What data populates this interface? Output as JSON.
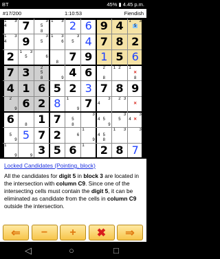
{
  "status_bar": {
    "left": "BT",
    "right_battery": "45%",
    "time": "4.45 p.m."
  },
  "info_bar": {
    "puzzle": "#17/200",
    "timer": "1:10:53",
    "difficulty": "Fiendish"
  },
  "hint": {
    "title": "Locked Candidates (Pointing, block)",
    "p1": "All the candidates for ",
    "digit": "digit 5",
    "p2": " in ",
    "block": "block 3",
    "p3": " are located in the intersection with ",
    "column": "column C9",
    "p4": ". Since one of the intersecting cells must contain the ",
    "digit2": "digit 5",
    "p5": ", it can be eliminated as candidate from the cells in ",
    "column2": "column C9",
    "p6": " outside the intersection."
  },
  "toolbar": {
    "buttons": [
      {
        "name": "back-button",
        "glyph": "⇐",
        "color": "#e07a10"
      },
      {
        "name": "minus-button",
        "glyph": "−",
        "color": "#e07a10"
      },
      {
        "name": "plus-button",
        "glyph": "+",
        "color": "#e07a10"
      },
      {
        "name": "close-button",
        "glyph": "✖",
        "color": "#d81c1c"
      },
      {
        "name": "forward-button",
        "glyph": "⇒",
        "color": "#e07a10"
      }
    ]
  },
  "colors": {
    "highlight_block": "#f5e3a6",
    "candidate_box": "#8ac6ff",
    "row_shade": "#cfcfcf",
    "elimination": "#d8261c"
  },
  "grid": [
    [
      {
        "v": "",
        "c": [
          "1",
          "3",
          "4"
        ]
      },
      {
        "v": "7",
        "t": "g"
      },
      {
        "v": "",
        "c": [
          "3",
          "5",
          "8"
        ]
      },
      {
        "v": "",
        "c": [
          "1",
          "3"
        ]
      },
      {
        "v": "2",
        "t": "p"
      },
      {
        "v": "6",
        "t": "p"
      },
      {
        "v": "9",
        "t": "g"
      },
      {
        "v": "4",
        "t": "g"
      },
      {
        "v": "",
        "c": [
          "1",
          "3",
          "5"
        ]
      }
    ],
    [
      {
        "v": "",
        "c": [
          "1",
          "3",
          "4"
        ]
      },
      {
        "v": "9",
        "t": "g"
      },
      {
        "v": "",
        "c": [
          "3",
          "5"
        ]
      },
      {
        "v": "",
        "c": [
          "1",
          "3",
          "6"
        ]
      },
      {
        "v": "",
        "c": [
          "3",
          "5"
        ]
      },
      {
        "v": "4",
        "t": "p"
      },
      {
        "v": "7",
        "t": "g"
      },
      {
        "v": "8",
        "t": "g"
      },
      {
        "v": "2",
        "t": "g"
      }
    ],
    [
      {
        "v": "2",
        "t": "g"
      },
      {
        "v": "",
        "c": [
          "1",
          "3",
          "5"
        ]
      },
      {
        "v": "",
        "c": [
          "6"
        ]
      },
      {
        "v": "",
        "c": [
          "8"
        ]
      },
      {
        "v": "7",
        "t": "g"
      },
      {
        "v": "9",
        "t": "g"
      },
      {
        "v": "1",
        "t": "p"
      },
      {
        "v": "5",
        "t": "g"
      },
      {
        "v": "6",
        "t": "p"
      }
    ],
    [
      {
        "v": "7",
        "t": "g"
      },
      {
        "v": "3",
        "t": "g"
      },
      {
        "v": "",
        "c": [
          "2",
          "5",
          "8"
        ]
      },
      {
        "v": "",
        "c": [
          "9"
        ]
      },
      {
        "v": "4",
        "t": "g"
      },
      {
        "v": "6",
        "t": "g"
      },
      {
        "v": "",
        "c": [
          "2",
          "8"
        ]
      },
      {
        "v": "",
        "c": [
          "1",
          "2"
        ]
      },
      {
        "v": "",
        "c": [
          "1",
          "5",
          "8"
        ],
        "x": "5"
      }
    ],
    [
      {
        "v": "4",
        "t": "g"
      },
      {
        "v": "1",
        "t": "g"
      },
      {
        "v": "6",
        "t": "g"
      },
      {
        "v": "5",
        "t": "g"
      },
      {
        "v": "2",
        "t": "g"
      },
      {
        "v": "3",
        "t": "p"
      },
      {
        "v": "7",
        "t": "g"
      },
      {
        "v": "8",
        "t": "g"
      },
      {
        "v": "9",
        "t": "g"
      }
    ],
    [
      {
        "v": "",
        "c": [
          "2",
          "9"
        ]
      },
      {
        "v": "6",
        "t": "g"
      },
      {
        "v": "2",
        "t": "g"
      },
      {
        "v": "8",
        "t": "p"
      },
      {
        "v": "",
        "c": [
          "1",
          "9"
        ]
      },
      {
        "v": "7",
        "t": "g"
      },
      {
        "v": "",
        "c": [
          "3",
          "4"
        ]
      },
      {
        "v": "",
        "c": [
          "2",
          "3"
        ]
      },
      {
        "v": "",
        "c": [
          "5"
        ],
        "x": "5"
      }
    ],
    [
      {
        "v": "6",
        "t": "g"
      },
      {
        "v": "",
        "c": [
          "8"
        ]
      },
      {
        "v": "1",
        "t": "g"
      },
      {
        "v": "7",
        "t": "g"
      },
      {
        "v": "",
        "c": [
          "5",
          "8"
        ]
      },
      {
        "v": "",
        "c": [
          "3"
        ]
      },
      {
        "v": "",
        "c": [
          "4",
          "5",
          "9"
        ]
      },
      {
        "v": "",
        "c": [
          "3",
          "5"
        ]
      },
      {
        "v": "",
        "c": [
          "3",
          "4",
          "5"
        ],
        "x": "5"
      }
    ],
    [
      {
        "v": "",
        "c": [
          "5",
          "9"
        ]
      },
      {
        "v": "5",
        "t": "p"
      },
      {
        "v": "7",
        "t": "g"
      },
      {
        "v": "2",
        "t": "g"
      },
      {
        "v": "",
        "c": [
          "6"
        ]
      },
      {
        "v": "",
        "c": [
          "1",
          "9"
        ]
      },
      {
        "v": "",
        "c": [
          "4",
          "5",
          "8"
        ]
      },
      {
        "v": "",
        "c": [
          "1",
          "3"
        ]
      },
      {
        "v": "",
        "c": [
          "3"
        ]
      }
    ],
    [
      {
        "v": "",
        "c": [
          "1",
          "9"
        ]
      },
      {
        "v": "",
        "c": [
          "9"
        ]
      },
      {
        "v": "3",
        "t": "g"
      },
      {
        "v": "5",
        "t": "g"
      },
      {
        "v": "6",
        "t": "g"
      },
      {
        "v": "",
        "c": [
          "1"
        ]
      },
      {
        "v": "2",
        "t": "g"
      },
      {
        "v": "8",
        "t": "g"
      },
      {
        "v": "7",
        "t": "p"
      }
    ]
  ]
}
